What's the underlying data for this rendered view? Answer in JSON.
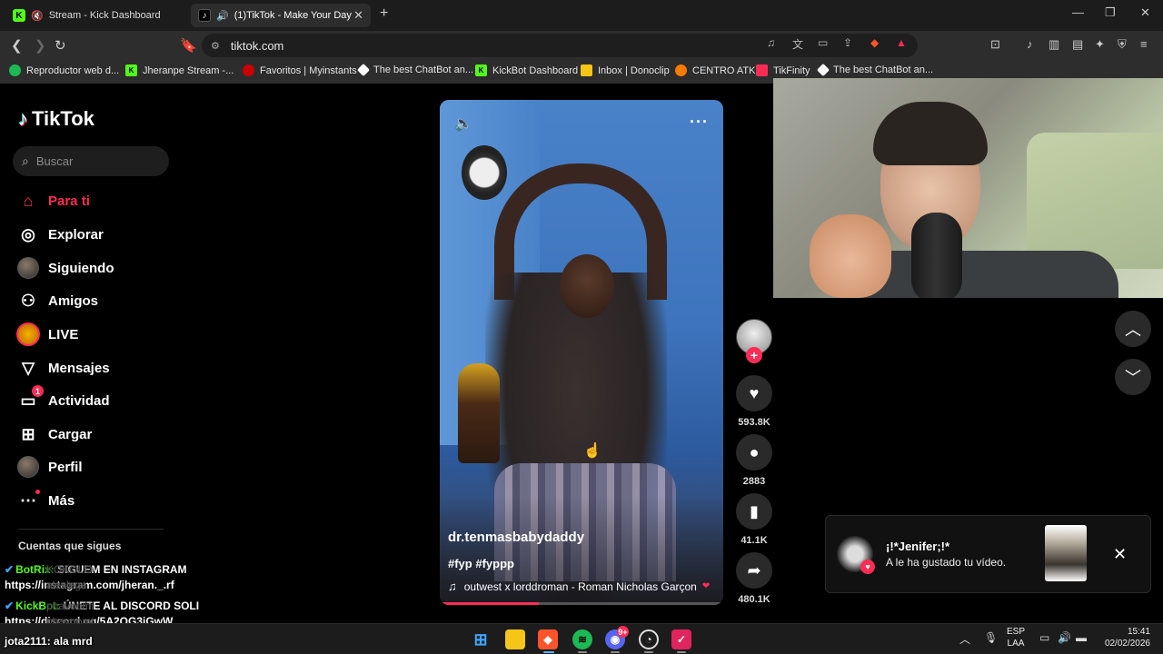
{
  "browser": {
    "tabs": [
      {
        "title": "Stream - Kick Dashboard"
      },
      {
        "title": "(1)TikTok - Make Your Day"
      }
    ],
    "url": "tiktok.com",
    "bookmarks": [
      {
        "label": "Reproductor web d..."
      },
      {
        "label": "Jheranpe Stream -..."
      },
      {
        "label": "Favoritos | Myinstants"
      },
      {
        "label": "The best ChatBot an..."
      },
      {
        "label": "KickBot Dashboard"
      },
      {
        "label": "Inbox | Donoclip"
      },
      {
        "label": "CENTRO ATK"
      },
      {
        "label": "TikFinity"
      },
      {
        "label": "The best ChatBot an..."
      }
    ]
  },
  "tiktok": {
    "logo": "TikTok",
    "search_placeholder": "Buscar",
    "nav": [
      {
        "label": "Para ti"
      },
      {
        "label": "Explorar"
      },
      {
        "label": "Siguiendo"
      },
      {
        "label": "Amigos"
      },
      {
        "label": "LIVE"
      },
      {
        "label": "Mensajes"
      },
      {
        "label": "Actividad",
        "badge": "1"
      },
      {
        "label": "Cargar"
      },
      {
        "label": "Perfil"
      },
      {
        "label": "Más"
      }
    ],
    "following_header": "Cuentas que sigues",
    "video": {
      "author": "dr.tenmasbabydaddy",
      "hashtags": "#fyp #fyppp",
      "music": "outwest x lorddroman - Roman Nicholas Garçon",
      "progress": 0.35
    },
    "actions": {
      "likes": "593.8K",
      "comments": "2883",
      "saves": "41.1K",
      "shares": "480.1K"
    },
    "notification": {
      "name": "¡!*Jenifer;!*",
      "text": "A le ha gustado tu vídeo."
    }
  },
  "chat": [
    {
      "user": "BotRix:",
      "message": " SIGUEM EN INSTAGRAM"
    },
    {
      "message": "https://instagram.com/jheran._.rf"
    },
    {
      "user": "KickBot:",
      "message": " ÚNETE AL DISCORD SOLI"
    },
    {
      "message": "https://discord.gg/5A2QG3jGwW"
    },
    {
      "user": "jota2111:",
      "message": " ala mrd"
    }
  ],
  "chat_underlay": [
    "KOKOLO",
    "alexlegs",
    "phavoomi",
    "phavoomi"
  ],
  "taskbar": {
    "discord_badge": "9+",
    "lang_top": "ESP",
    "lang_bottom": "LAA",
    "time": "15:41",
    "date": "02/02/2026"
  },
  "colors": {
    "accent": "#fe2c55",
    "kick_green": "#53fc18"
  }
}
